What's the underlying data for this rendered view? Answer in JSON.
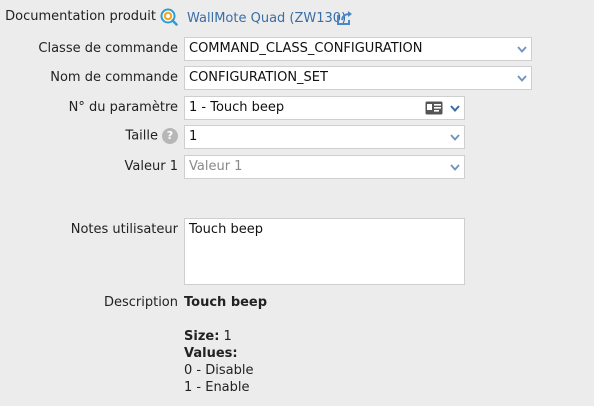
{
  "doc": {
    "label": "Documentation produit",
    "product_link": "WallMote Quad (ZW130)",
    "icons": [
      "zwave-search-icon",
      "open-external-icon"
    ]
  },
  "form": {
    "command_class": {
      "label": "Classe de commande",
      "value": "COMMAND_CLASS_CONFIGURATION"
    },
    "command_name": {
      "label": "Nom de commande",
      "value": "CONFIGURATION_SET"
    },
    "parameter": {
      "label": "N° du paramètre",
      "value": "1 - Touch beep",
      "icons": [
        "id-card-icon"
      ]
    },
    "size": {
      "label": "Taille",
      "help": "?",
      "value": "1"
    },
    "value1": {
      "label": "Valeur 1",
      "placeholder": "Valeur 1"
    },
    "notes": {
      "label": "Notes utilisateur",
      "value": "Touch beep"
    }
  },
  "description": {
    "label": "Description",
    "title": "Touch beep",
    "size_label": "Size:",
    "size_value": "1",
    "values_label": "Values:",
    "values": [
      "0 - Disable",
      "1 - Enable"
    ]
  },
  "colors": {
    "background": "#ececec",
    "link": "#3a6ea5",
    "arrow": "#3b6aa8"
  }
}
